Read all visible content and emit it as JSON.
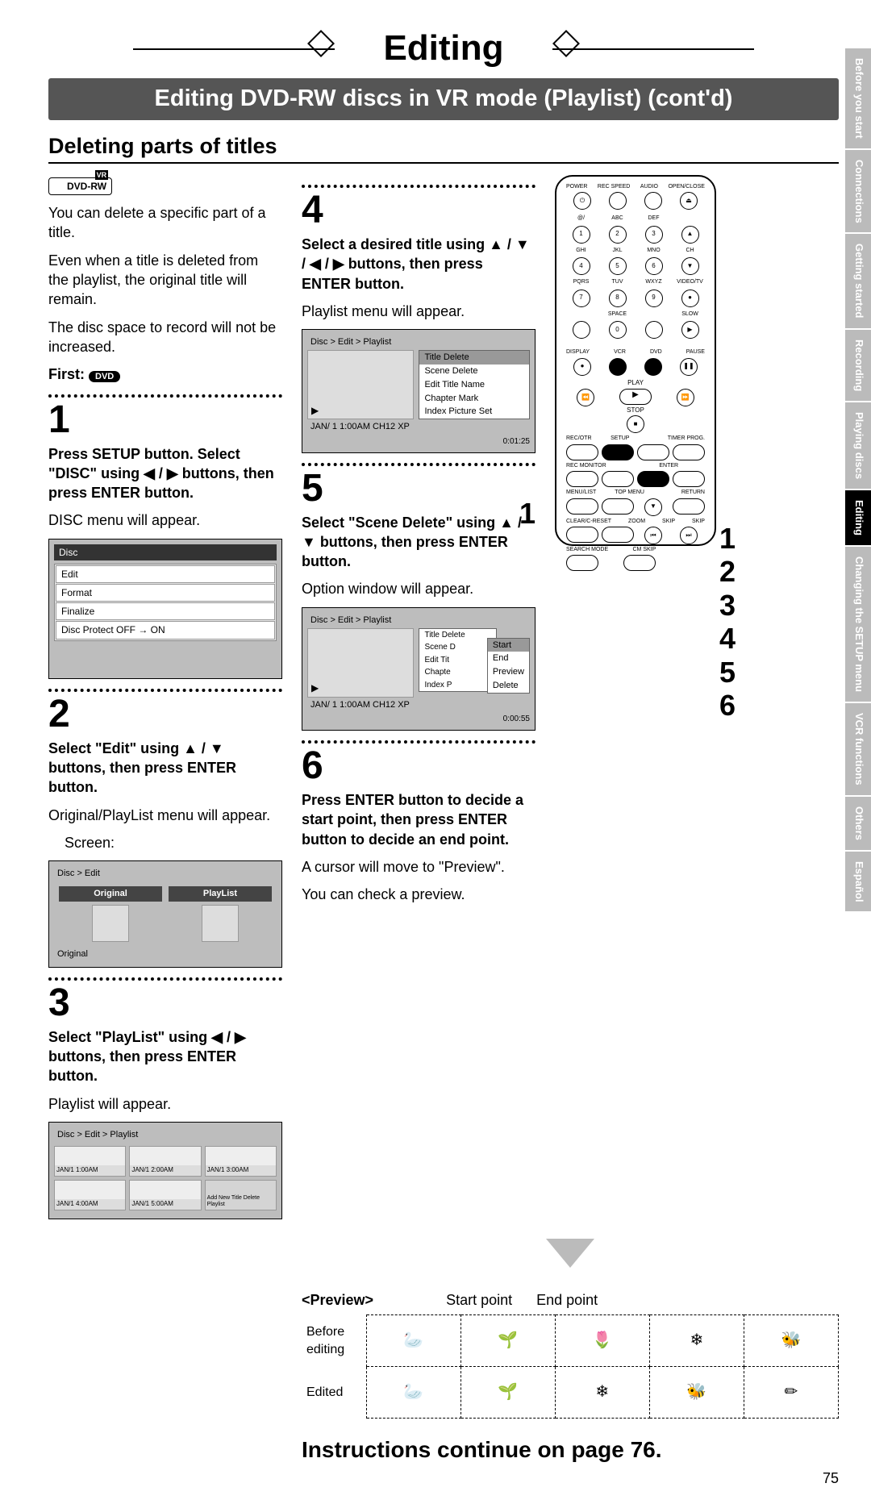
{
  "title": "Editing",
  "subtitle": "Editing DVD-RW discs in VR mode (Playlist) (cont'd)",
  "section": "Deleting parts of titles",
  "dvdrw_logo": "DVD-RW",
  "dvdrw_vr": "VR",
  "intro": {
    "p1": "You can delete a specific part of a title.",
    "p2": "Even when a title is deleted from the playlist, the original title will remain.",
    "p3": "The disc space to record will not be increased."
  },
  "first_label": "First:",
  "first_badge": "DVD",
  "steps": {
    "s1": {
      "num": "1",
      "bold": "Press SETUP button. Select \"DISC\" using ◀ / ▶ buttons, then press ENTER button.",
      "after": "DISC menu will appear."
    },
    "s2": {
      "num": "2",
      "bold": "Select \"Edit\" using ▲ / ▼ buttons, then press ENTER button.",
      "after": "Original/PlayList menu will appear.",
      "screen_label": "Screen:"
    },
    "s3": {
      "num": "3",
      "bold": "Select \"PlayList\" using ◀ / ▶ buttons, then press ENTER button.",
      "after": "Playlist will appear."
    },
    "s4": {
      "num": "4",
      "bold": "Select a desired title using ▲ / ▼ / ◀ / ▶ buttons, then press ENTER button.",
      "after": "Playlist menu will appear."
    },
    "s5": {
      "num": "5",
      "bold": "Select \"Scene Delete\" using ▲ / ▼ buttons, then press ENTER button.",
      "after": "Option window will appear."
    },
    "s6": {
      "num": "6",
      "bold": "Press ENTER button to decide a start point, then press ENTER button to decide an end point.",
      "after1": "A cursor will move to \"Preview\".",
      "after2": "You can check a preview."
    }
  },
  "disc_menu": {
    "header": "Disc",
    "items": [
      "Edit",
      "Format",
      "Finalize",
      "Disc Protect OFF → ON"
    ]
  },
  "edit_menu": {
    "bc": "Disc > Edit",
    "original": "Original",
    "playlist": "PlayList",
    "caption": "Original"
  },
  "playlist_grid": {
    "bc": "Disc > Edit > Playlist",
    "thumbs": [
      "JAN/1  1:00AM",
      "JAN/1  2:00AM",
      "JAN/1  3:00AM",
      "JAN/1  4:00AM",
      "JAN/1  5:00AM"
    ],
    "add": "Add New Title Delete Playlist"
  },
  "playlist_menu": {
    "bc": "Disc > Edit > Playlist",
    "items": [
      "Title Delete",
      "Scene Delete",
      "Edit Title Name",
      "Chapter Mark",
      "Index Picture Set"
    ],
    "selected_index": 0,
    "status": "JAN/ 1   1:00AM  CH12    XP",
    "time": "0:01:25"
  },
  "scene_menu": {
    "bc": "Disc > Edit > Playlist",
    "items_left": [
      "Title Delete",
      "Scene D",
      "Edit Tit",
      "Chapte",
      "Index P"
    ],
    "popup": [
      "Start",
      "End",
      "Preview",
      "Delete"
    ],
    "popup_sel": 0,
    "status": "JAN/ 1   1:00AM  CH12    XP",
    "time": "0:00:55"
  },
  "preview": {
    "head": "<Preview>",
    "start": "Start point",
    "end": "End point",
    "before": "Before editing",
    "edited": "Edited"
  },
  "continue": "Instructions continue on page 76.",
  "page_number": "75",
  "tabs": [
    "Before you start",
    "Connections",
    "Getting started",
    "Recording",
    "Playing discs",
    "Editing",
    "Changing the SETUP menu",
    "VCR functions",
    "Others",
    "Español"
  ],
  "active_tab_index": 5,
  "remote": {
    "row1": [
      "POWER",
      "REC SPEED",
      "AUDIO",
      "OPEN/CLOSE"
    ],
    "numpad_labels": [
      "@/",
      "ABC",
      "DEF",
      "",
      "GHI",
      "JKL",
      "MNO",
      "CH",
      "PQRS",
      "TUV",
      "WXYZ",
      "VIDEO/TV",
      "",
      "SPACE",
      "",
      "SLOW"
    ],
    "numpad": [
      "1",
      "2",
      "3",
      "▲",
      "4",
      "5",
      "6",
      "▼",
      "7",
      "8",
      "9",
      "●",
      "",
      "0",
      "",
      "▶"
    ],
    "row_disp": [
      "DISPLAY",
      "VCR",
      "DVD",
      "PAUSE"
    ],
    "play": "PLAY",
    "stop": "STOP",
    "row_rec": [
      "REC/OTR",
      "SETUP",
      "",
      "TIMER PROG."
    ],
    "row_mon": [
      "REC MONITOR",
      "",
      "ENTER",
      ""
    ],
    "row_menu": [
      "MENU/LIST",
      "TOP MENU",
      "",
      "RETURN"
    ],
    "row_clear": [
      "CLEAR/C-RESET",
      "ZOOM",
      "SKIP",
      "SKIP"
    ],
    "row_search": [
      "SEARCH MODE",
      "CM SKIP",
      "",
      ""
    ]
  },
  "right_numbers": [
    "1",
    "2",
    "3",
    "4",
    "5",
    "6"
  ]
}
